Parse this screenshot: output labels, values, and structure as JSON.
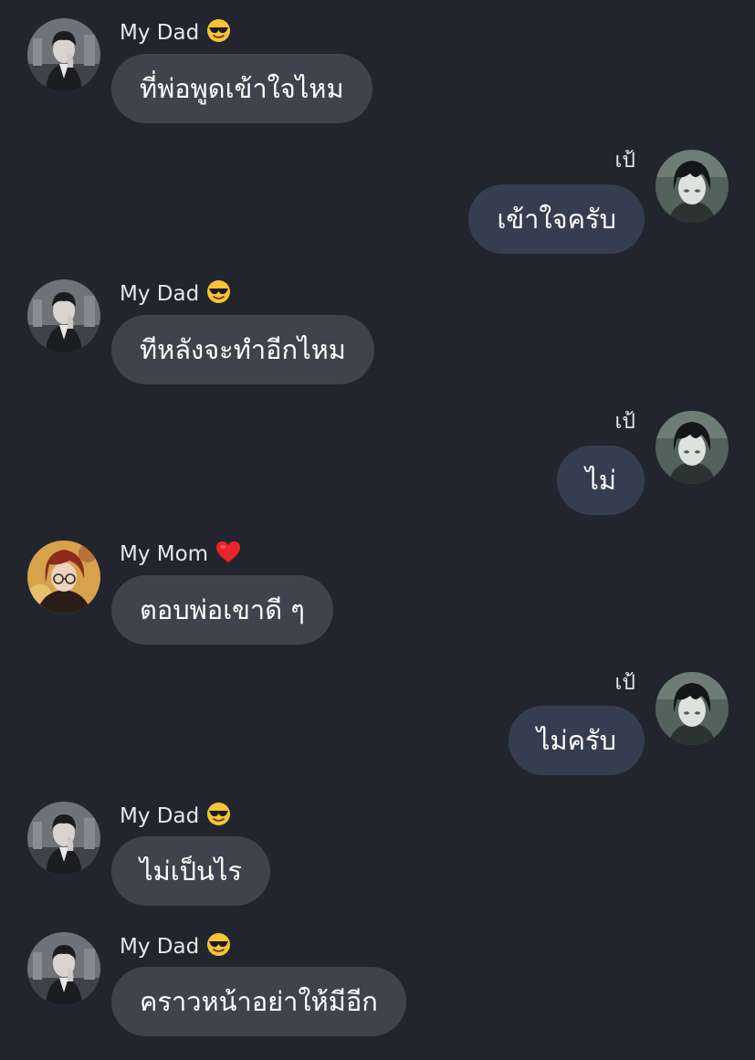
{
  "conversation": {
    "messages": [
      {
        "direction": "in",
        "sender": "My Dad",
        "emoji": "sunglasses-face-emoji",
        "text": "ที่พ่อพูดเข้าใจไหม"
      },
      {
        "direction": "out",
        "sender": "เป้",
        "text": "เข้าใจครับ"
      },
      {
        "direction": "in",
        "sender": "My Dad",
        "emoji": "sunglasses-face-emoji",
        "text": "ทีหลังจะทำอีกไหม"
      },
      {
        "direction": "out",
        "sender": "เป้",
        "text": "ไม่"
      },
      {
        "direction": "in",
        "sender": "My Mom",
        "emoji": "red-heart-emoji",
        "text": "ตอบพ่อเขาดี ๆ"
      },
      {
        "direction": "out",
        "sender": "เป้",
        "text": "ไม่ครับ"
      },
      {
        "direction": "in",
        "sender": "My Dad",
        "emoji": "sunglasses-face-emoji",
        "text": "ไม่เป็นไร"
      },
      {
        "direction": "in",
        "sender": "My Dad",
        "emoji": "sunglasses-face-emoji",
        "text": "คราวหน้าอย่าให้มีอีก"
      }
    ]
  },
  "colors": {
    "background": "#23252e",
    "incoming_bubble": "#40434d",
    "outgoing_bubble": "#353d50",
    "sender_text": "#e6e7ea",
    "bubble_text": "#ffffff"
  }
}
